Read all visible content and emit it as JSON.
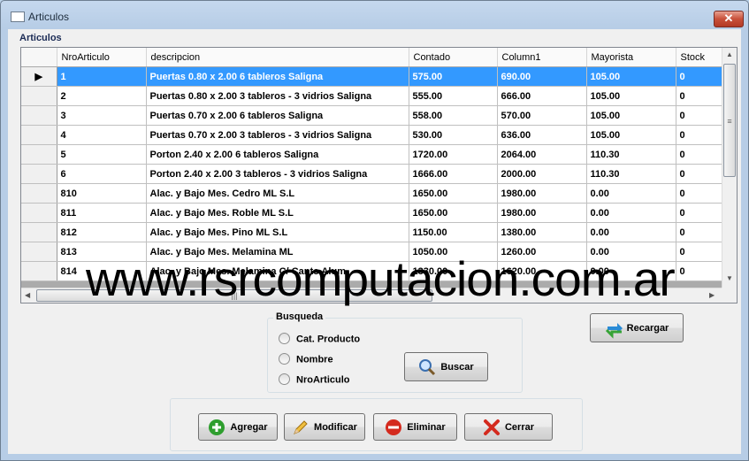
{
  "window": {
    "title": "Articulos",
    "close_label": "✕"
  },
  "grid_group": {
    "label": "Articulos"
  },
  "grid": {
    "columns": [
      "NroArticulo",
      "descripcion",
      "Contado",
      "Column1",
      "Mayorista",
      "Stock"
    ],
    "rows": [
      [
        "1",
        "Puertas  0.80 x 2.00 6 tableros Saligna",
        "575.00",
        "690.00",
        "105.00",
        "0"
      ],
      [
        "2",
        "Puertas 0.80 x 2.00 3 tableros - 3 vidrios Saligna",
        "555.00",
        "666.00",
        "105.00",
        "0"
      ],
      [
        "3",
        "Puertas 0.70 x 2.00 6 tableros Saligna",
        "558.00",
        "570.00",
        "105.00",
        "0"
      ],
      [
        "4",
        "Puertas 0.70 x 2.00 3 tableros - 3 vidrios Saligna",
        "530.00",
        "636.00",
        "105.00",
        "0"
      ],
      [
        "5",
        "Porton 2.40 x 2.00 6 tableros Saligna",
        "1720.00",
        "2064.00",
        "110.30",
        "0"
      ],
      [
        "6",
        "Porton 2.40 x 2.00 3 tableros - 3 vidrios Saligna",
        "1666.00",
        "2000.00",
        "110.30",
        "0"
      ],
      [
        "810",
        "Alac. y Bajo Mes. Cedro ML S.L",
        "1650.00",
        "1980.00",
        "0.00",
        "0"
      ],
      [
        "811",
        "Alac. y Bajo Mes. Roble ML S.L",
        "1650.00",
        "1980.00",
        "0.00",
        "0"
      ],
      [
        "812",
        "Alac. y Bajo Mes. Pino ML S.L",
        "1150.00",
        "1380.00",
        "0.00",
        "0"
      ],
      [
        "813",
        "Alac. y Bajo Mes. Melamina ML",
        "1050.00",
        "1260.00",
        "0.00",
        "0"
      ],
      [
        "814",
        "Alac. y Bajo Mes. Melamina C/ Canto Alum",
        "1330.00",
        "1620.00",
        "0.00",
        "0"
      ]
    ],
    "selected_row": 0,
    "current_row_marker": "▶"
  },
  "watermark": "www.rsrcomputacion.com.ar",
  "search": {
    "legend": "Busqueda",
    "options": [
      "Cat. Producto",
      "Nombre",
      "NroArticulo"
    ],
    "search_button": "Buscar"
  },
  "reload_button": "Recargar",
  "actions": {
    "add": "Agregar",
    "edit": "Modificar",
    "delete": "Eliminar",
    "close": "Cerrar"
  },
  "colors": {
    "selection": "#3399ff",
    "add_icon": "#2e9e2e",
    "delete_icon": "#d42a1e",
    "close_icon": "#d42a1e"
  }
}
